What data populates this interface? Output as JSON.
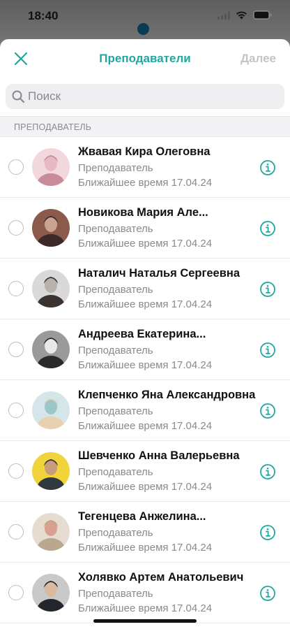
{
  "status_bar": {
    "time": "18:40",
    "icons": [
      "signal-icon",
      "wifi-icon",
      "battery-icon"
    ]
  },
  "header": {
    "close_icon": "close-icon",
    "title": "Преподаватели",
    "next_label": "Далее"
  },
  "search": {
    "placeholder": "Поиск",
    "value": ""
  },
  "section": {
    "title": "ПРЕПОДАВАТЕЛЬ"
  },
  "teachers": [
    {
      "name": "Жвавая Кира Олеговна",
      "role": "Преподаватель",
      "nearest": "Ближайшее время 17.04.24",
      "selected": false,
      "avatar_colors": [
        "#f2d8dc",
        "#c98a9a",
        "#e8b8c4"
      ]
    },
    {
      "name": "Новикова Мария Але...",
      "role": "Преподаватель",
      "nearest": "Ближайшее время 17.04.24",
      "selected": false,
      "avatar_colors": [
        "#8b5a4a",
        "#3c2a28",
        "#c9a591"
      ]
    },
    {
      "name": "Наталич Наталья Сергеевна",
      "role": "Преподаватель",
      "nearest": "Ближайшее время 17.04.24",
      "selected": false,
      "avatar_colors": [
        "#d9d9d9",
        "#3a3330",
        "#b9b1ab"
      ]
    },
    {
      "name": "Андреева Екатерина...",
      "role": "Преподаватель",
      "nearest": "Ближайшее время 17.04.24",
      "selected": false,
      "avatar_colors": [
        "#9a9a9a",
        "#2a2a2a",
        "#e9e9e9"
      ]
    },
    {
      "name": "Клепченко Яна Александровна",
      "role": "Преподаватель",
      "nearest": "Ближайшее время 17.04.24",
      "selected": false,
      "avatar_colors": [
        "#d4e6ea",
        "#e8d1b0",
        "#9bc7c9"
      ]
    },
    {
      "name": "Шевченко Анна Валерьевна",
      "role": "Преподаватель",
      "nearest": "Ближайшее время 17.04.24",
      "selected": false,
      "avatar_colors": [
        "#f0d43a",
        "#2f3a40",
        "#c99c7c"
      ]
    },
    {
      "name": "Тегенцева Анжелина...",
      "role": "Преподаватель",
      "nearest": "Ближайшее время 17.04.24",
      "selected": false,
      "avatar_colors": [
        "#e5ddd0",
        "#b9a88e",
        "#d8a090"
      ]
    },
    {
      "name": "Холявко Артем Анатольевич",
      "role": "Преподаватель",
      "nearest": "Ближайшее время 17.04.24",
      "selected": false,
      "avatar_colors": [
        "#c9c9c9",
        "#23262c",
        "#d9b9a0"
      ]
    }
  ],
  "colors": {
    "accent": "#1fa7a0",
    "disabled": "#c4c4c4",
    "secondary_text": "#8a8a8e"
  }
}
